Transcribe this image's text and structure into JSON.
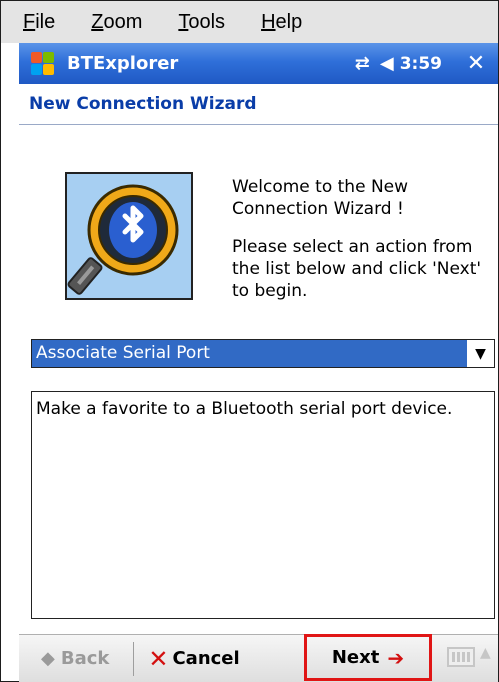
{
  "menubar": {
    "items": [
      {
        "accel": "F",
        "rest": "ile"
      },
      {
        "accel": "Z",
        "rest": "oom"
      },
      {
        "accel": "T",
        "rest": "ools"
      },
      {
        "accel": "H",
        "rest": "elp"
      }
    ]
  },
  "titlebar": {
    "app_name": "BTExplorer",
    "clock": "3:59",
    "close_label": "✕"
  },
  "wizard": {
    "title": "New Connection Wizard",
    "welcome": "Welcome to the New Connection Wizard !",
    "instructions": "Please select an action from the list below and click 'Next' to begin.",
    "selected_action": "Associate Serial Port",
    "description": "Make a favorite to a Bluetooth serial port device."
  },
  "toolbar": {
    "back_label": "Back",
    "cancel_label": "Cancel",
    "next_label": "Next"
  },
  "icons": {
    "start": "windows-flag-icon",
    "connectivity": "connectivity-icon",
    "volume": "volume-icon",
    "close": "close-icon",
    "wizard_image": "bluetooth-magnifier-icon",
    "dropdown": "chevron-down-icon",
    "back": "arrow-left-icon",
    "cancel": "x-icon",
    "next": "arrow-right-icon",
    "keyboard": "keyboard-icon"
  },
  "colors": {
    "titlebar": "#2f6fd9",
    "selection": "#316ac5",
    "wizard_title": "#0a3da8",
    "highlight_border": "#e01515"
  }
}
